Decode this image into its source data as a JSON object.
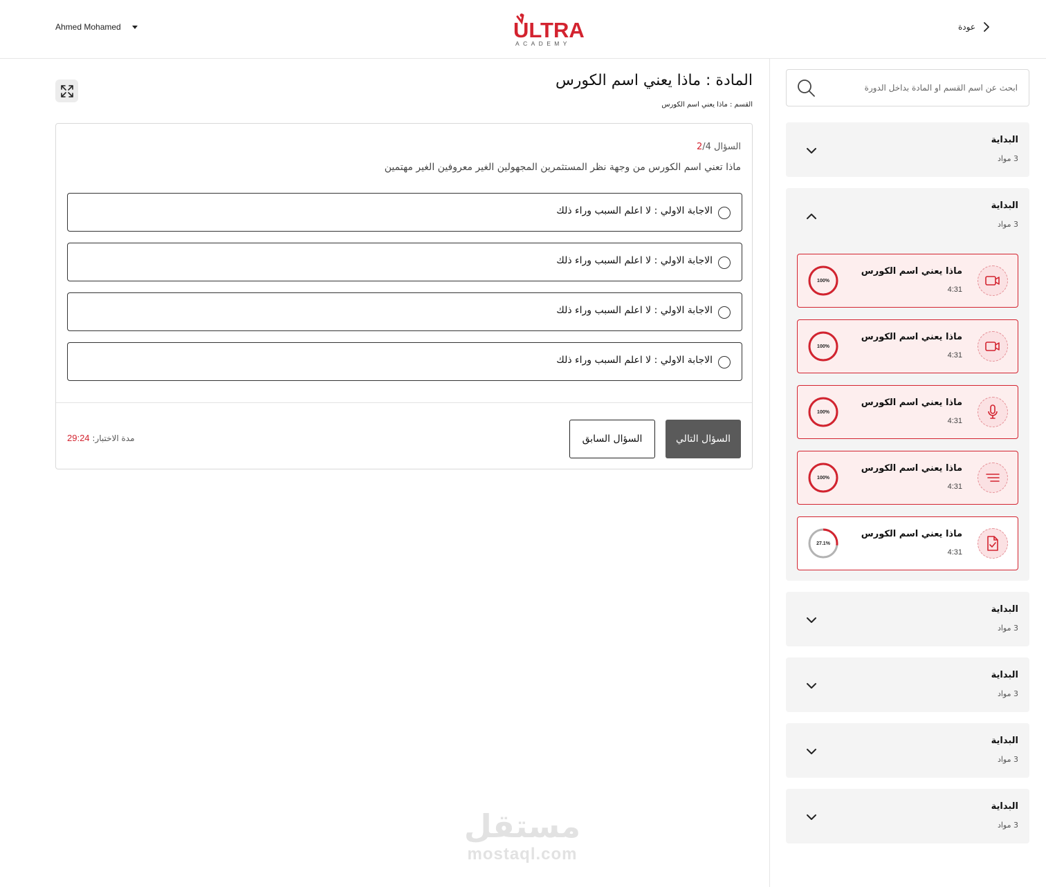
{
  "header": {
    "user_name": "Ahmed Mohamed",
    "logo_text": "ULTRA",
    "logo_subtext": "ACADEMY",
    "back_label": "عودة"
  },
  "colors": {
    "accent": "#d3232f",
    "item_bg": "#fdeeee",
    "section_bg": "#f4f4f4",
    "next_button": "#5a5a5a"
  },
  "sidebar": {
    "search_placeholder": "ابحث عن اسم القسم او المادة بداخل الدورة",
    "sections": [
      {
        "title": "البداية",
        "count": "3 مواد",
        "expanded": false
      },
      {
        "title": "البداية",
        "count": "3 مواد",
        "expanded": true,
        "items": [
          {
            "title": "ماذا يعني اسم الكورس",
            "duration": "4:31",
            "icon": "video-icon",
            "progress": 100,
            "progress_label": "100%"
          },
          {
            "title": "ماذا يعني اسم الكورس",
            "duration": "4:31",
            "icon": "video-icon",
            "progress": 100,
            "progress_label": "100%"
          },
          {
            "title": "ماذا يعني اسم الكورس",
            "duration": "4:31",
            "icon": "microphone-icon",
            "progress": 100,
            "progress_label": "100%"
          },
          {
            "title": "ماذا يعني اسم الكورس",
            "duration": "4:31",
            "icon": "text-lines-icon",
            "progress": 100,
            "progress_label": "100%"
          },
          {
            "title": "ماذا يعني اسم الكورس",
            "duration": "4:31",
            "icon": "quiz-document-icon",
            "progress": 27.1,
            "progress_label": "27.1%"
          }
        ]
      },
      {
        "title": "البداية",
        "count": "3 مواد",
        "expanded": false
      },
      {
        "title": "البداية",
        "count": "3 مواد",
        "expanded": false
      },
      {
        "title": "البداية",
        "count": "3 مواد",
        "expanded": false
      },
      {
        "title": "البداية",
        "count": "3 مواد",
        "expanded": false
      }
    ]
  },
  "main": {
    "title": "المادة : ماذا يعني اسم الكورس",
    "breadcrumb": "القسم : ماذا يعني اسم الكورس",
    "quiz": {
      "question_prefix": "السؤال",
      "question_current": "2",
      "question_total": "/4",
      "question_text": "ماذا تعني اسم الكورس من وجهة نظر المستثمرين المجهولين الغير معروفين الغير مهتمين",
      "answers": [
        "الاجابة الاولي : لا اعلم السبب وراء ذلك",
        "الاجابة الاولي : لا اعلم السبب وراء ذلك",
        "الاجابة الاولي : لا اعلم السبب وراء ذلك",
        "الاجابة الاولي : لا اعلم السبب وراء ذلك"
      ],
      "next_label": "السؤال التالي",
      "prev_label": "السؤال السابق",
      "timer_label": "مدة الاختبار:",
      "timer_value": "29:24"
    }
  },
  "watermark": {
    "arabic": "مستقل",
    "latin": "mostaql.com"
  }
}
